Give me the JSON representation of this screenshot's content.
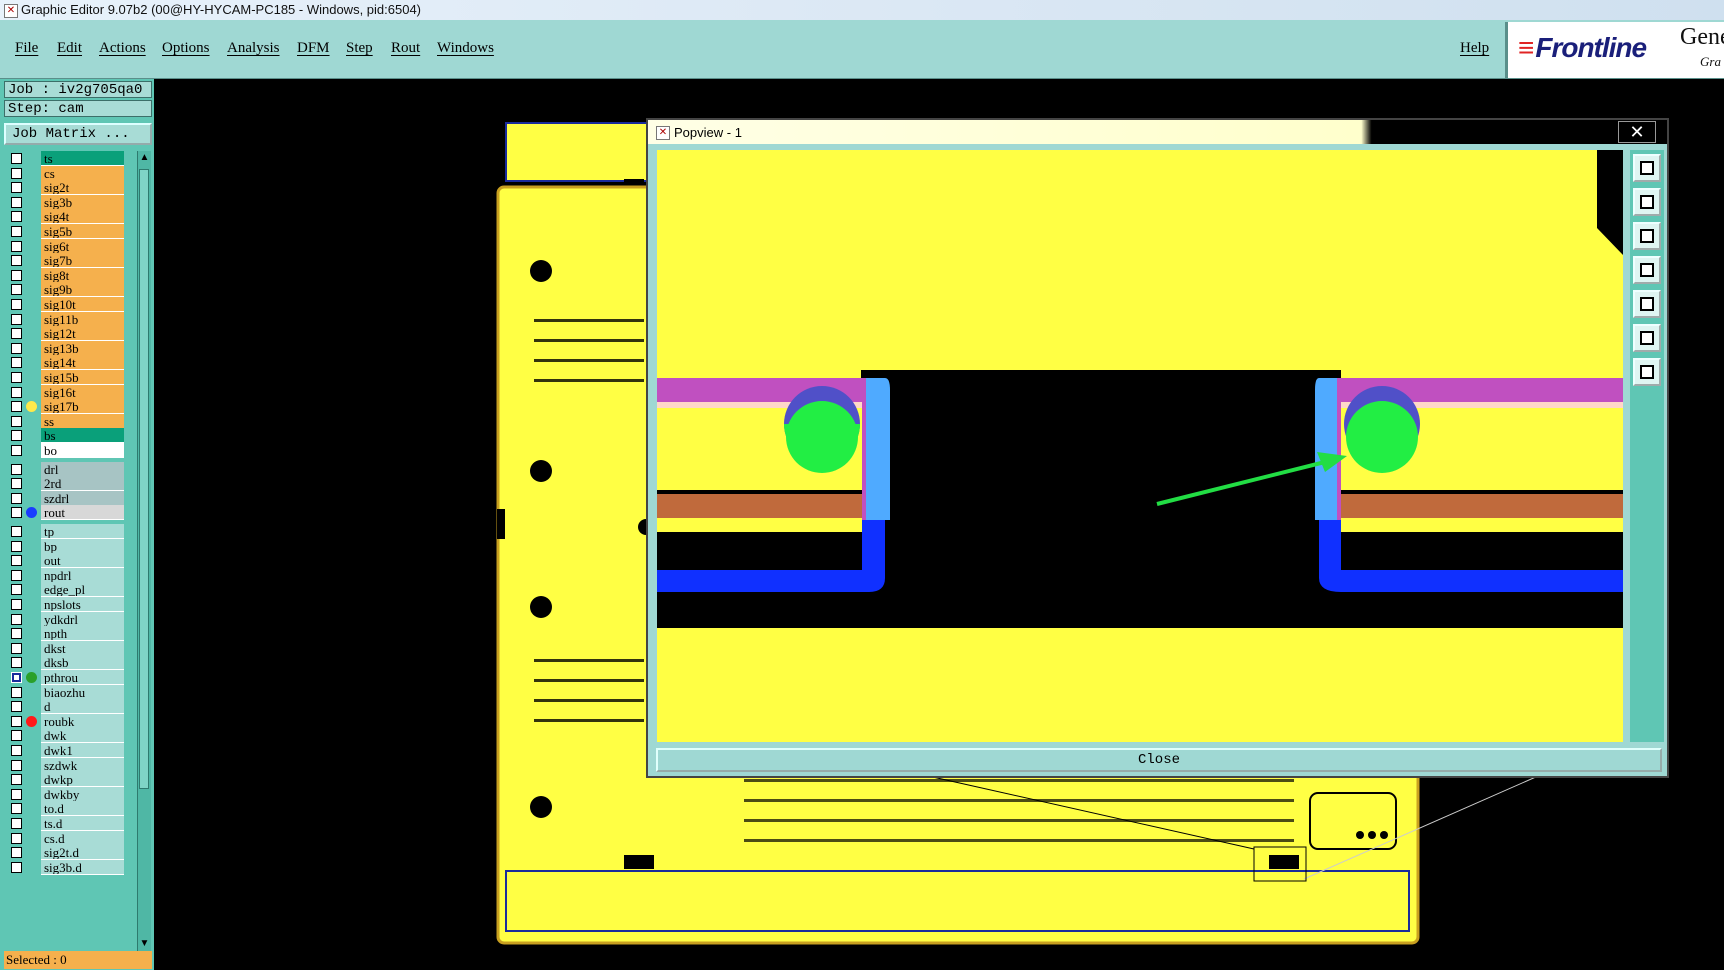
{
  "window": {
    "title": "Graphic Editor 9.07b2 (00@HY-HYCAM-PC185 - Windows, pid:6504)"
  },
  "menu": {
    "items": [
      "File",
      "Edit",
      "Actions",
      "Options",
      "Analysis",
      "DFM",
      "Step",
      "Rout",
      "Windows"
    ],
    "help": "Help"
  },
  "brand": {
    "logo": "Frontline",
    "suffix": "Gene",
    "suffix2": "Gra"
  },
  "job": {
    "job_label": "Job : iv2g705qa0",
    "step_label": "Step: cam",
    "matrix_button": "Job Matrix ..."
  },
  "layers": [
    {
      "name": "ts",
      "color": "#0aa07a"
    },
    {
      "name": "cs",
      "color": "#f5b04d"
    },
    {
      "name": "sig2t",
      "color": "#f5b04d"
    },
    {
      "name": "sig3b",
      "color": "#f5b04d"
    },
    {
      "name": "sig4t",
      "color": "#f5b04d"
    },
    {
      "name": "sig5b",
      "color": "#f5b04d"
    },
    {
      "name": "sig6t",
      "color": "#f5b04d"
    },
    {
      "name": "sig7b",
      "color": "#f5b04d"
    },
    {
      "name": "sig8t",
      "color": "#f5b04d"
    },
    {
      "name": "sig9b",
      "color": "#f5b04d"
    },
    {
      "name": "sig10t",
      "color": "#f5b04d"
    },
    {
      "name": "sig11b",
      "color": "#f5b04d"
    },
    {
      "name": "sig12t",
      "color": "#f5b04d"
    },
    {
      "name": "sig13b",
      "color": "#f5b04d"
    },
    {
      "name": "sig14t",
      "color": "#f5b04d"
    },
    {
      "name": "sig15b",
      "color": "#f5b04d"
    },
    {
      "name": "sig16t",
      "color": "#f5b04d"
    },
    {
      "name": "sig17b",
      "color": "#f5b04d",
      "dot": "#ffe94a"
    },
    {
      "name": "ss",
      "color": "#f5b04d"
    },
    {
      "name": "bs",
      "color": "#0aa07a"
    },
    {
      "name": "bo",
      "color": "#ffffff"
    },
    {
      "name": "drl",
      "color": "#a7c4c4",
      "gap": true
    },
    {
      "name": "2rd",
      "color": "#a7c4c4"
    },
    {
      "name": "szdrl",
      "color": "#a7c4c4"
    },
    {
      "name": "rout",
      "color": "#d8d8d8",
      "dot": "#1a3cff"
    },
    {
      "name": "tp",
      "color": "#a8dcd6",
      "gap": true
    },
    {
      "name": "bp",
      "color": "#a8dcd6"
    },
    {
      "name": "out",
      "color": "#a8dcd6"
    },
    {
      "name": "npdrl",
      "color": "#a8dcd6"
    },
    {
      "name": "edge_pl",
      "color": "#a8dcd6"
    },
    {
      "name": "npslots",
      "color": "#a8dcd6"
    },
    {
      "name": "ydkdrl",
      "color": "#a8dcd6"
    },
    {
      "name": "npth",
      "color": "#a8dcd6"
    },
    {
      "name": "dkst",
      "color": "#a8dcd6"
    },
    {
      "name": "dksb",
      "color": "#a8dcd6"
    },
    {
      "name": "pthrou",
      "color": "#a8dcd6",
      "dot": "#2aa02a",
      "active": true
    },
    {
      "name": "biaozhu",
      "color": "#a8dcd6"
    },
    {
      "name": "d",
      "color": "#a8dcd6"
    },
    {
      "name": "roubk",
      "color": "#a8dcd6",
      "dot": "#ff1a1a"
    },
    {
      "name": "dwk",
      "color": "#a8dcd6"
    },
    {
      "name": "dwk1",
      "color": "#a8dcd6"
    },
    {
      "name": "szdwk",
      "color": "#a8dcd6"
    },
    {
      "name": "dwkp",
      "color": "#a8dcd6"
    },
    {
      "name": "dwkby",
      "color": "#a8dcd6"
    },
    {
      "name": "to.d",
      "color": "#a8dcd6"
    },
    {
      "name": "ts.d",
      "color": "#a8dcd6"
    },
    {
      "name": "cs.d",
      "color": "#a8dcd6"
    },
    {
      "name": "sig2t.d",
      "color": "#a8dcd6"
    },
    {
      "name": "sig3b.d",
      "color": "#a8dcd6"
    }
  ],
  "status": {
    "selected": "Selected : 0"
  },
  "popview": {
    "title": "Popview - 1",
    "close_x": "✕",
    "close_button": "Close"
  }
}
